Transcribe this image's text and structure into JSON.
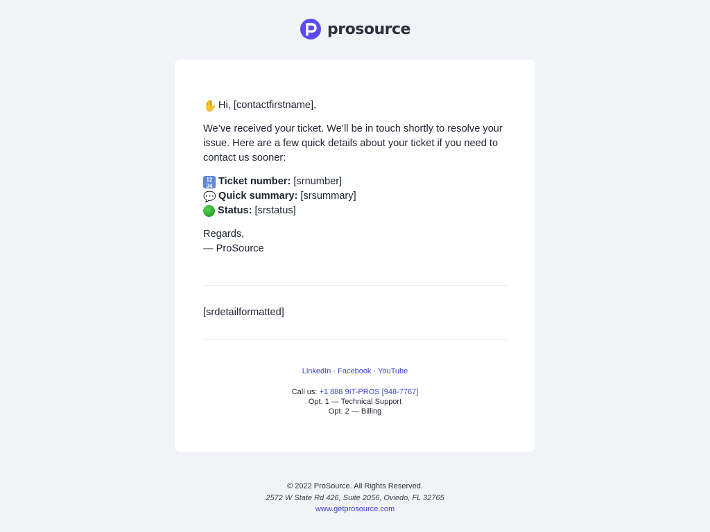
{
  "brand": {
    "name": "prosource",
    "logo_icon": "prosource-p-logo-icon",
    "accent": "#5b4cf0"
  },
  "email": {
    "greeting_emoji": "wave-hand-icon",
    "greeting": "Hi, [contactfirstname],",
    "intro": "We’ve received your ticket. We’ll be in touch shortly to resolve your issue. Here are a few quick details about your ticket if you need to contact us sooner:",
    "details": [
      {
        "icon": "numbers-icon",
        "label": "Ticket number:",
        "value": "[srnumber]"
      },
      {
        "icon": "speech-bubble-icon",
        "label": "Quick summary:",
        "value": "[srsummary]"
      },
      {
        "icon": "green-circle-icon",
        "label": "Status:",
        "value": "[srstatus]"
      }
    ],
    "regards": "Regards,",
    "signature": "— ProSource",
    "detail_placeholder": "[srdetailformatted]"
  },
  "socials": {
    "linkedin": "LinkedIn",
    "facebook": "Facebook",
    "youtube": "YouTube",
    "separator": "·"
  },
  "contact": {
    "call_prefix": "Call us:",
    "phone": "+1 888 9IT-PROS [948-7767]",
    "opt1": "Opt. 1 — Technical Support",
    "opt2": "Opt. 2 — Billing"
  },
  "footer": {
    "copyright": "© 2022 ProSource. All Rights Reserved.",
    "address": "2572 W State Rd 426, Suite 2056, Oviedo, FL 32765",
    "website": "www.getprosource.com"
  },
  "colors": {
    "background": "#f2f3f6",
    "card": "#ffffff",
    "link": "#3d3fd8",
    "text": "#1f2430"
  }
}
